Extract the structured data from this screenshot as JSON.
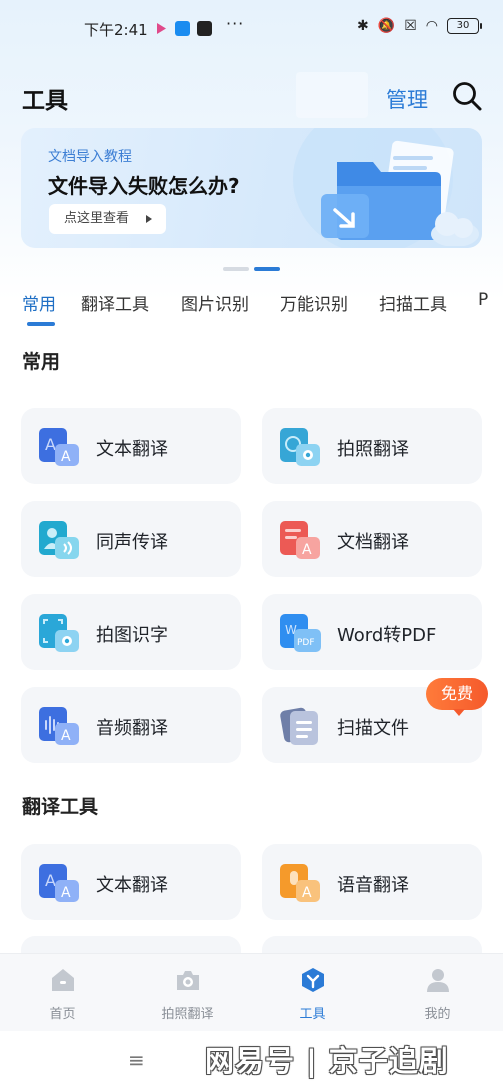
{
  "status_bar": {
    "time": "下午2:41",
    "dots": "···",
    "battery": "30"
  },
  "header": {
    "title": "工具",
    "manage_label": "管理"
  },
  "banner": {
    "subtitle": "文档导入教程",
    "title": "文件导入失败怎么办?",
    "button_label": "点这里查看"
  },
  "tabs": [
    {
      "label": "常用"
    },
    {
      "label": "翻译工具"
    },
    {
      "label": "图片识别"
    },
    {
      "label": "万能识别"
    },
    {
      "label": "扫描工具"
    },
    {
      "label": "P"
    }
  ],
  "sections": [
    {
      "title": "常用",
      "items": [
        {
          "label": "文本翻译",
          "icon": "text-translate-icon"
        },
        {
          "label": "拍照翻译",
          "icon": "photo-translate-icon"
        },
        {
          "label": "同声传译",
          "icon": "simultaneous-interpret-icon"
        },
        {
          "label": "文档翻译",
          "icon": "document-translate-icon"
        },
        {
          "label": "拍图识字",
          "icon": "photo-ocr-icon"
        },
        {
          "label": "Word转PDF",
          "icon": "word-to-pdf-icon"
        },
        {
          "label": "音频翻译",
          "icon": "audio-translate-icon"
        },
        {
          "label": "扫描文件",
          "icon": "scan-file-icon",
          "badge": "免费"
        }
      ]
    },
    {
      "title": "翻译工具",
      "items": [
        {
          "label": "文本翻译",
          "icon": "text-translate-icon"
        },
        {
          "label": "语音翻译",
          "icon": "voice-translate-icon"
        }
      ]
    }
  ],
  "bottom_nav": [
    {
      "label": "首页",
      "icon": "home-icon"
    },
    {
      "label": "拍照翻译",
      "icon": "camera-icon"
    },
    {
      "label": "工具",
      "icon": "tools-icon",
      "active": true
    },
    {
      "label": "我的",
      "icon": "profile-icon"
    }
  ],
  "watermark": "网易号 | 京子追剧",
  "colors": {
    "accent": "#2b7bd6",
    "badge": "#f55a2c",
    "card_bg": "#f4f6f9"
  }
}
